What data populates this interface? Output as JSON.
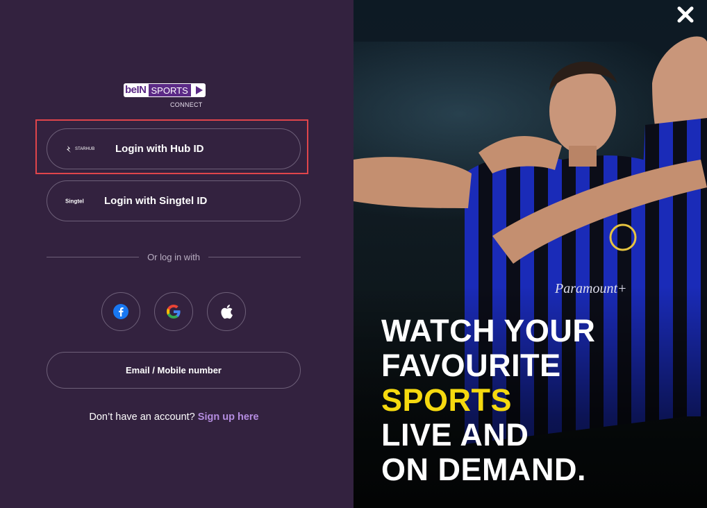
{
  "brand": {
    "logo_bein": "beIN",
    "logo_sports": "SPORTS",
    "logo_connect": "CONNECT"
  },
  "login": {
    "hub_label": "Login with Hub ID",
    "hub_icon_text": "STARHUB",
    "singtel_label": "Login with Singtel ID",
    "singtel_icon_text": "Singtel",
    "divider_text": "Or log in with",
    "email_label": "Email / Mobile number"
  },
  "social": {
    "facebook_icon": "facebook-icon",
    "google_icon": "google-icon",
    "apple_icon": "apple-icon"
  },
  "signup": {
    "prompt": "Don’t have an account?",
    "link": "Sign up here"
  },
  "promo": {
    "line1": "WATCH YOUR",
    "line2": "FAVOURITE",
    "line3": "SPORTS",
    "line4": "LIVE AND",
    "line5": "ON DEMAND."
  },
  "colors": {
    "left_bg": "#33223f",
    "accent_link": "#b48ce0",
    "highlight": "#f5d90f",
    "selection_border": "#e0454b"
  }
}
